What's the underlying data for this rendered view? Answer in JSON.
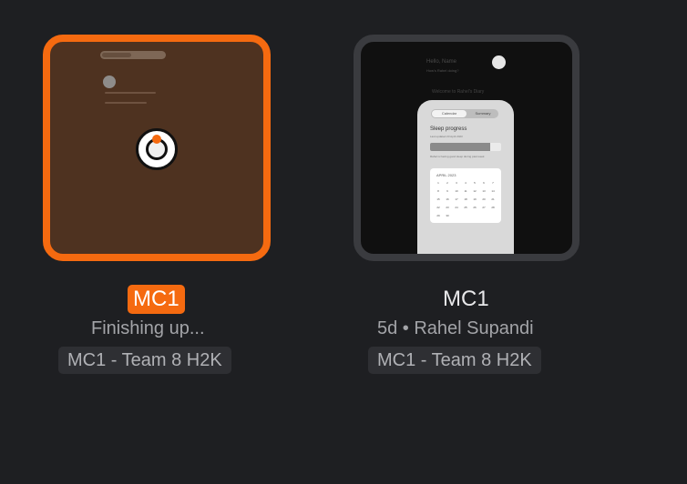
{
  "items": [
    {
      "title": "MC1",
      "subtitle": "Finishing up...",
      "project": "MC1 - Team 8 H2K",
      "selected": true,
      "accent_color": "#f56a10",
      "thumbnail_background": "#4e3220",
      "status_icon": "loading-spinner-icon"
    },
    {
      "title": "MC1",
      "subtitle": "5d • Rahel Supandi",
      "project": "MC1 - Team 8 H2K",
      "selected": false,
      "thumbnail_background": "#101010",
      "preview": {
        "greeting": "Hello, Name",
        "greeting_sub": "How's Rahel doing?",
        "welcome": "Welcome to Rahel's Diary",
        "tabs": [
          "Calendar",
          "Summary"
        ],
        "sleep_title": "Sleep progress",
        "sleep_sub": "Last updated 23 April 2023",
        "sleep_progress": 0.85,
        "sleep_note": "Rahel is having good sleep during past week",
        "calendar_month": "APRIL 2023",
        "calendar_days": [
          "1",
          "2",
          "3",
          "4",
          "5",
          "6",
          "7",
          "8",
          "9",
          "10",
          "11",
          "12",
          "13",
          "14",
          "15",
          "16",
          "17",
          "18",
          "19",
          "20",
          "21",
          "22",
          "23",
          "24",
          "25",
          "26",
          "27",
          "28",
          "29",
          "30"
        ]
      }
    }
  ]
}
